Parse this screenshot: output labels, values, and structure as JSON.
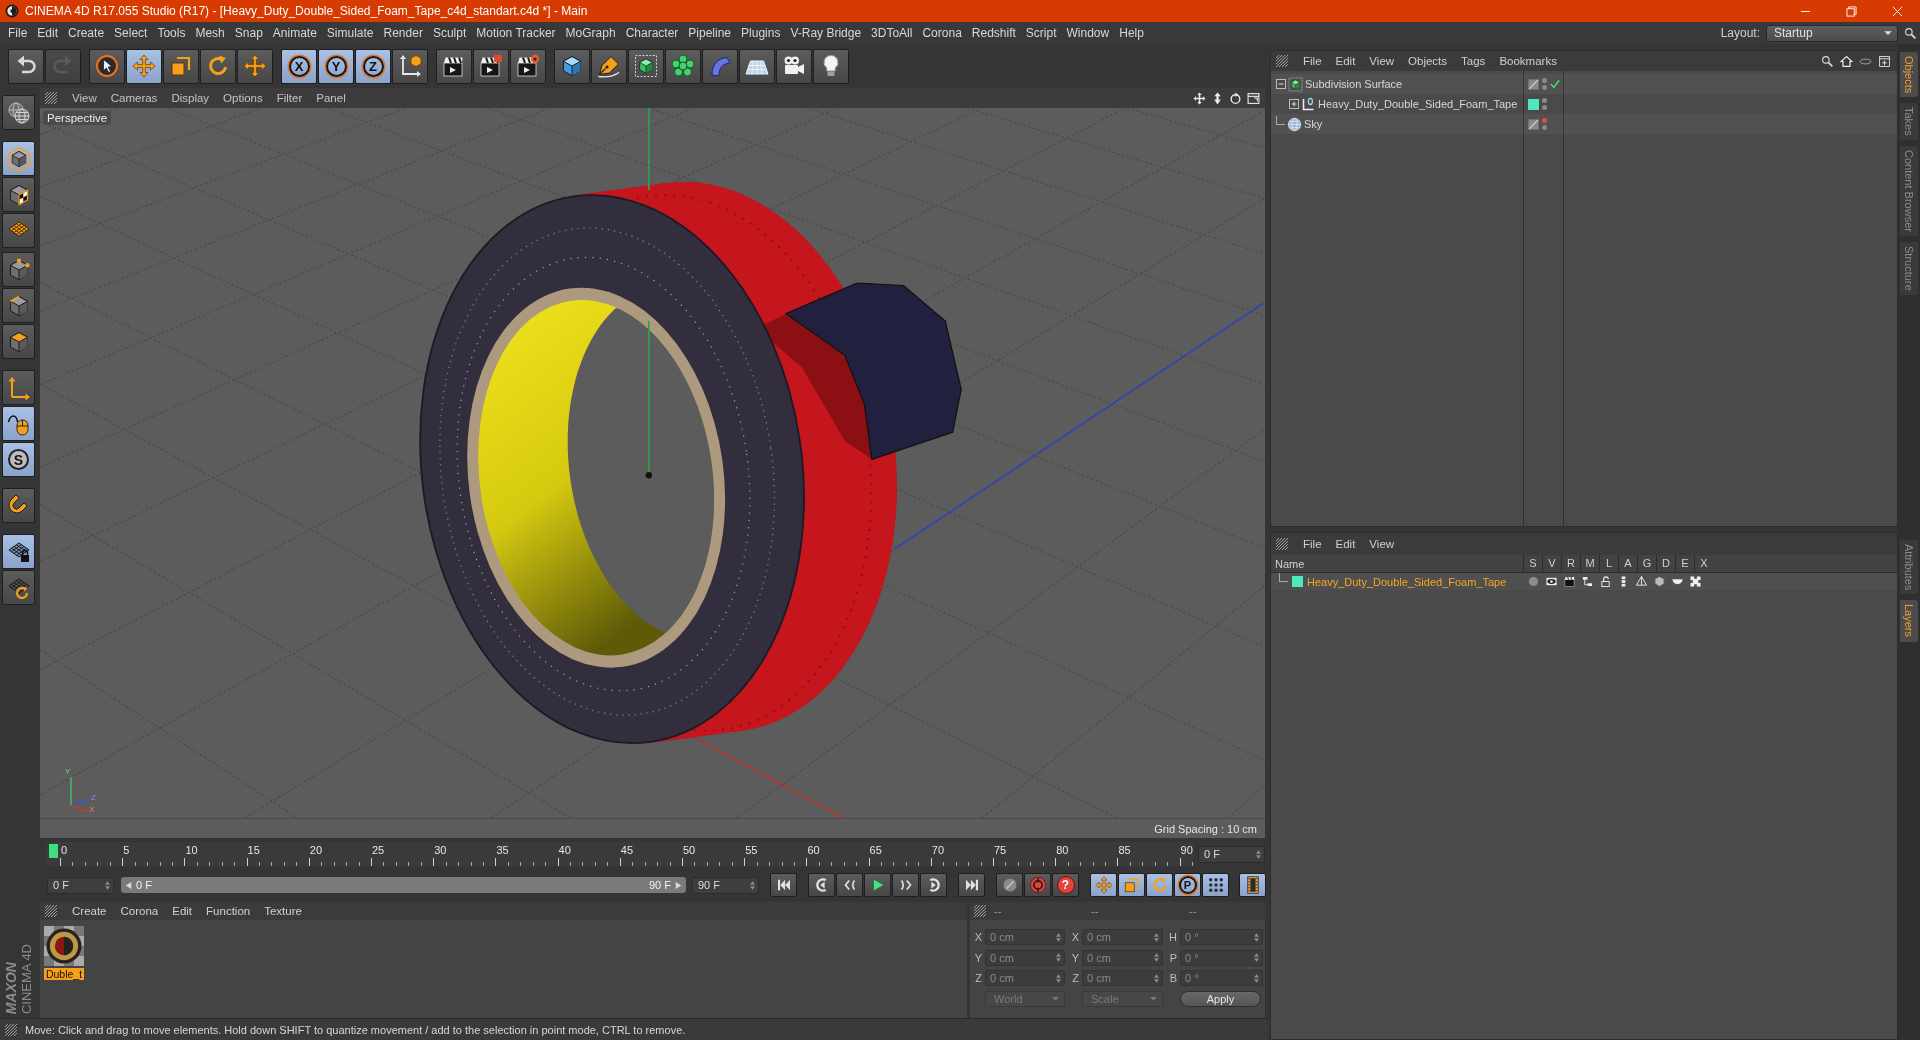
{
  "window": {
    "title": "CINEMA 4D R17.055 Studio (R17) - [Heavy_Duty_Double_Sided_Foam_Tape_c4d_standart.c4d *] - Main"
  },
  "menu_bar": {
    "items": [
      "File",
      "Edit",
      "Create",
      "Select",
      "Tools",
      "Mesh",
      "Snap",
      "Animate",
      "Simulate",
      "Render",
      "Sculpt",
      "Motion Tracker",
      "MoGraph",
      "Character",
      "Pipeline",
      "Plugins",
      "V-Ray Bridge",
      "3DToAll",
      "Corona",
      "Redshift",
      "Script",
      "Window",
      "Help"
    ],
    "layout_label": "Layout:",
    "layout_value": "Startup"
  },
  "toolbar": [
    {
      "buttons": [
        {
          "kind": "undo",
          "disabled": false
        },
        {
          "kind": "redo",
          "disabled": true
        }
      ]
    },
    {
      "buttons": [
        {
          "kind": "live-selection",
          "selected": false
        },
        {
          "kind": "move",
          "selected": true
        },
        {
          "kind": "scale",
          "selected": false
        },
        {
          "kind": "rotate",
          "selected": false
        },
        {
          "kind": "recent-tool",
          "selected": false
        }
      ]
    },
    {
      "buttons": [
        {
          "kind": "axis-lock",
          "label": "X",
          "selected": true
        },
        {
          "kind": "axis-lock",
          "label": "Y",
          "selected": true
        },
        {
          "kind": "axis-lock",
          "label": "Z",
          "selected": true
        },
        {
          "kind": "coordinate-system",
          "selected": false
        }
      ]
    },
    {
      "buttons": [
        {
          "kind": "render-view"
        },
        {
          "kind": "render-to-viewer"
        },
        {
          "kind": "render-settings"
        }
      ]
    },
    {
      "buttons": [
        {
          "kind": "cube"
        },
        {
          "kind": "pen"
        },
        {
          "kind": "subdivision"
        },
        {
          "kind": "cloner"
        },
        {
          "kind": "deformer"
        },
        {
          "kind": "floor"
        },
        {
          "kind": "camera"
        },
        {
          "kind": "light"
        }
      ]
    }
  ],
  "left_toolbar": [
    {
      "buttons": [
        {
          "kind": "workplane-view",
          "selected": false
        }
      ]
    },
    {
      "buttons": [
        {
          "kind": "model-mode",
          "selected": true
        },
        {
          "kind": "texture-mode",
          "selected": false
        },
        {
          "kind": "workplane-mode",
          "selected": false
        }
      ]
    },
    {
      "buttons": [
        {
          "kind": "points-mode",
          "selected": false
        },
        {
          "kind": "edges-mode",
          "selected": false
        },
        {
          "kind": "polygons-mode",
          "selected": false
        }
      ]
    },
    {
      "buttons": [
        {
          "kind": "axis-mode",
          "selected": false
        },
        {
          "kind": "tweak-mode",
          "selected": true
        },
        {
          "kind": "solo",
          "label": "S",
          "selected": true
        }
      ]
    },
    {
      "buttons": [
        {
          "kind": "snap",
          "selected": false
        }
      ]
    },
    {
      "buttons": [
        {
          "kind": "workplane-lock",
          "selected": true
        },
        {
          "kind": "locked-workplane",
          "selected": false
        }
      ]
    }
  ],
  "viewport": {
    "menu": [
      "View",
      "Cameras",
      "Display",
      "Options",
      "Filter",
      "Panel"
    ],
    "camera": "Perspective",
    "axis_labels": [
      "Y",
      "Z",
      "X"
    ],
    "grid_spacing": "Grid Spacing : 10 cm"
  },
  "timeline": {
    "frame_labels": [
      "0",
      "5",
      "10",
      "15",
      "20",
      "25",
      "30",
      "35",
      "40",
      "45",
      "50",
      "55",
      "60",
      "65",
      "70",
      "75",
      "80",
      "85",
      "90"
    ],
    "current_frame": "0 F"
  },
  "transport": {
    "start_frame": "0 F",
    "range": {
      "start": "0 F",
      "end": "90 F",
      "level": 1
    },
    "end_frame": "90 F",
    "groups": [
      {
        "buttons": [
          {
            "kind": "go-to-start"
          }
        ]
      },
      {
        "buttons": [
          {
            "kind": "previous-key"
          },
          {
            "kind": "previous-frame"
          },
          {
            "kind": "play"
          },
          {
            "kind": "next-frame"
          },
          {
            "kind": "next-key"
          }
        ]
      },
      {
        "buttons": [
          {
            "kind": "go-to-end"
          }
        ]
      },
      {
        "buttons": [
          {
            "kind": "record-key"
          },
          {
            "kind": "autokey"
          },
          {
            "kind": "key-help",
            "label": "?"
          }
        ]
      },
      {
        "buttons": [
          {
            "kind": "key-position",
            "selected": true
          },
          {
            "kind": "key-scale",
            "selected": true
          },
          {
            "kind": "key-rotation",
            "selected": true
          },
          {
            "kind": "key-parameter",
            "label": "P",
            "selected": true
          },
          {
            "kind": "key-points",
            "selected": true
          }
        ]
      },
      {
        "buttons": [
          {
            "kind": "timeline-window",
            "selected": true
          }
        ]
      }
    ]
  },
  "materials": {
    "menu": [
      "Create",
      "Corona",
      "Edit",
      "Function",
      "Texture"
    ],
    "items": [
      {
        "name": "Duble_t",
        "selected": true
      }
    ]
  },
  "coordinates": {
    "headers": [
      "--",
      "--",
      "--"
    ],
    "rows": [
      {
        "cells": [
          {
            "axis": "X",
            "value": "0 cm"
          },
          {
            "axis": "X",
            "value": "0 cm"
          },
          {
            "axis": "H",
            "value": "0 °"
          }
        ]
      },
      {
        "cells": [
          {
            "axis": "Y",
            "value": "0 cm"
          },
          {
            "axis": "Y",
            "value": "0 cm"
          },
          {
            "axis": "P",
            "value": "0 °"
          }
        ]
      },
      {
        "cells": [
          {
            "axis": "Z",
            "value": "0 cm"
          },
          {
            "axis": "Z",
            "value": "0 cm"
          },
          {
            "axis": "B",
            "value": "0 °"
          }
        ]
      }
    ],
    "dropdowns": [
      {
        "value": "World",
        "disabled": true
      },
      {
        "value": "Scale",
        "disabled": true
      }
    ],
    "apply": "Apply"
  },
  "status_bar": {
    "text": "Move: Click and drag to move elements. Hold down SHIFT to quantize movement / add to the selection in point mode, CTRL to remove."
  },
  "logo": {
    "brand": "MAXON",
    "product": "CINEMA 4D"
  },
  "object_manager": {
    "menu": [
      "File",
      "Edit",
      "View",
      "Objects",
      "Tags",
      "Bookmarks"
    ],
    "objects": [
      {
        "name": "Subdivision Surface",
        "kind": "subdivision",
        "expanded": true,
        "enabled": true,
        "editor_hidden": false,
        "children": [
          {
            "name": "Heavy_Duty_Double_Sided_Foam_Tape",
            "kind": "null",
            "expanded": false,
            "color": "#4fe8bd",
            "editor_hidden": false
          }
        ]
      },
      {
        "name": "Sky",
        "kind": "sky",
        "editor_hidden": true
      }
    ]
  },
  "layer_manager": {
    "menu": [
      "File",
      "Edit",
      "View"
    ],
    "name_column": "Name",
    "flag_columns": [
      {
        "label": "S",
        "kind": "solo"
      },
      {
        "label": "V",
        "kind": "view"
      },
      {
        "label": "R",
        "kind": "render"
      },
      {
        "label": "M",
        "kind": "manager"
      },
      {
        "label": "L",
        "kind": "lock"
      },
      {
        "label": "A",
        "kind": "animation"
      },
      {
        "label": "G",
        "kind": "generators"
      },
      {
        "label": "D",
        "kind": "deformers"
      },
      {
        "label": "E",
        "kind": "expressions"
      },
      {
        "label": "X",
        "kind": "xrefs"
      }
    ],
    "layers": [
      {
        "name": "Heavy_Duty_Double_Sided_Foam_Tape",
        "color": "#4fe8bd",
        "selected": true
      }
    ]
  },
  "side_tabs": {
    "upper": [
      {
        "label": "Objects",
        "selected": true
      },
      {
        "label": "Takes",
        "selected": false
      },
      {
        "label": "Content Browser",
        "selected": false
      },
      {
        "label": "Structure",
        "selected": false
      }
    ],
    "lower": [
      {
        "label": "Attributes",
        "selected": false
      },
      {
        "label": "Layers",
        "selected": true
      }
    ]
  }
}
